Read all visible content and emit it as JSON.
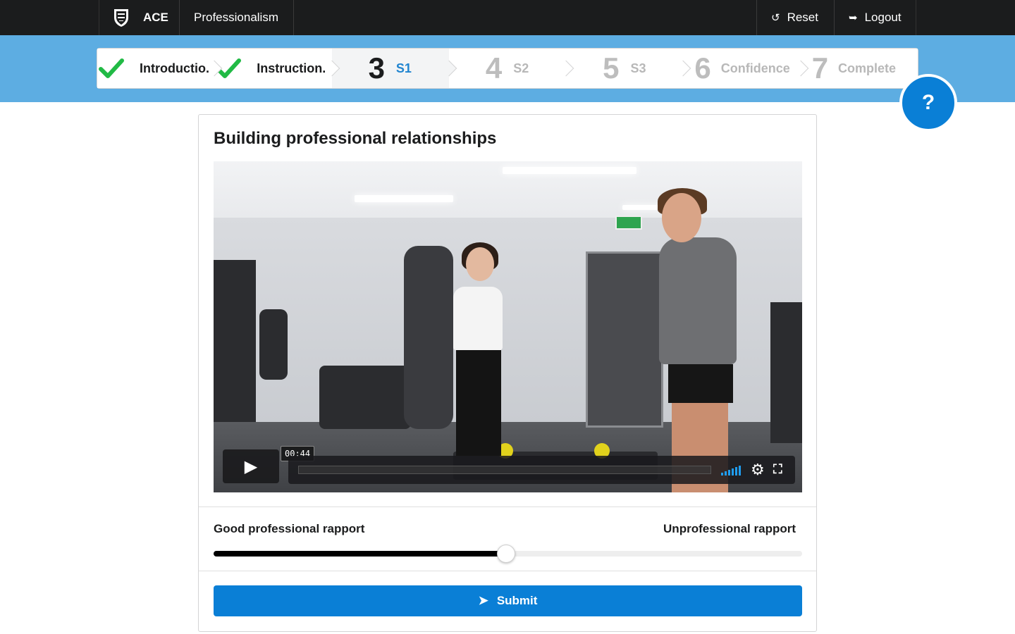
{
  "topbar": {
    "brand": "ACE",
    "module": "Professionalism",
    "reset_label": "Reset",
    "logout_label": "Logout",
    "logo_icon": "crest-icon",
    "reset_icon": "undo-icon",
    "logout_icon": "sign-out-icon"
  },
  "steps": [
    {
      "label": "Introductio.",
      "state": "completed"
    },
    {
      "label": "Instruction.",
      "state": "completed"
    },
    {
      "number": "3",
      "label": "S1",
      "state": "active"
    },
    {
      "number": "4",
      "label": "S2",
      "state": "disabled"
    },
    {
      "number": "5",
      "label": "S3",
      "state": "disabled"
    },
    {
      "number": "6",
      "label": "Confidence",
      "state": "disabled"
    },
    {
      "number": "7",
      "label": "Complete",
      "state": "disabled"
    }
  ],
  "help": {
    "label": "?"
  },
  "card": {
    "title": "Building professional relationships"
  },
  "video": {
    "timecode": "00:44",
    "progress": 0.0
  },
  "slider": {
    "left_label": "Good professional rapport",
    "right_label": "Unprofessional rapport",
    "value": 0.497
  },
  "submit": {
    "label": "Submit",
    "icon": "paper-plane-icon"
  },
  "colors": {
    "accent": "#0a7fd6",
    "band": "#5dade2",
    "active_step": "#2185d0",
    "check": "#21ba45",
    "topbar": "#1b1c1d"
  }
}
